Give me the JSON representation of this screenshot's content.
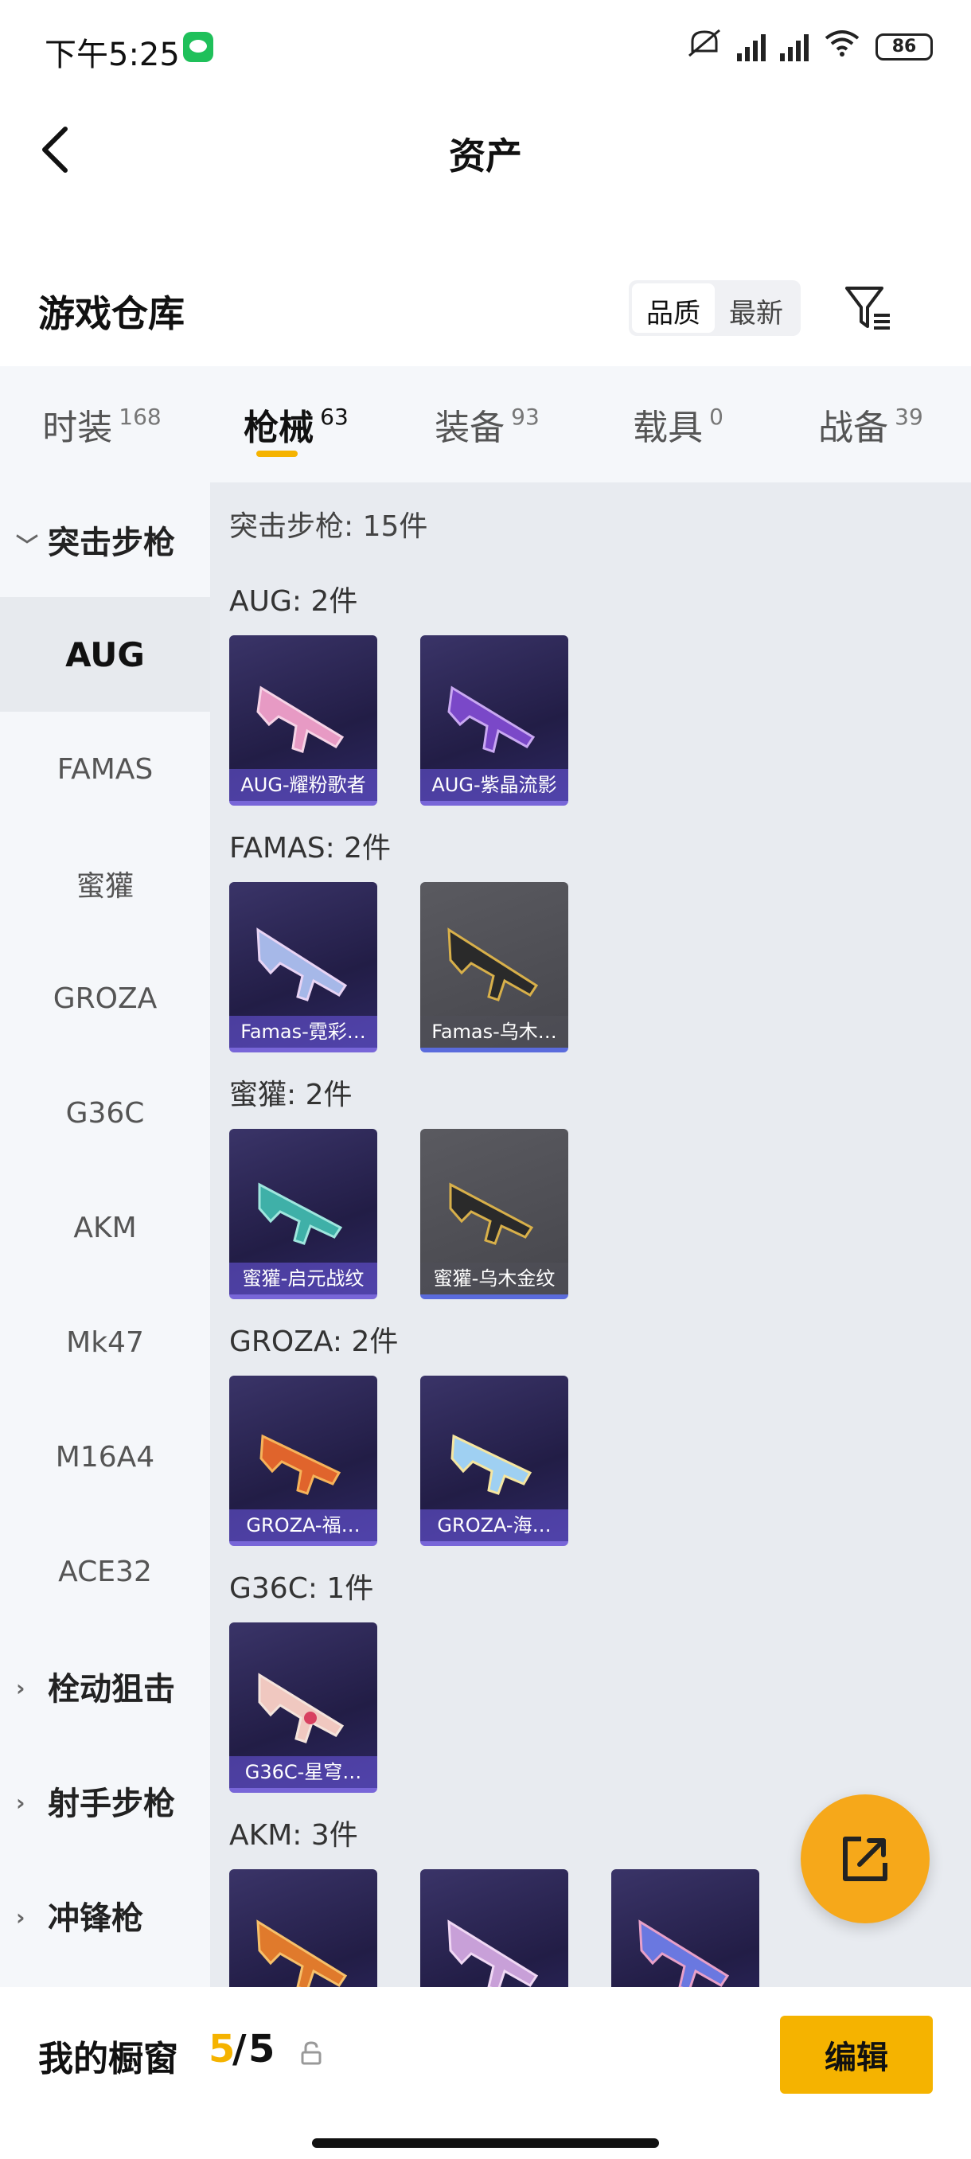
{
  "status_bar": {
    "time": "下午5:25",
    "battery": "86"
  },
  "header": {
    "title": "资产"
  },
  "warehouse": {
    "title": "游戏仓库",
    "sort_options": [
      "品质",
      "最新"
    ],
    "active_sort": "品质"
  },
  "tabs": [
    {
      "label": "时装",
      "count": "168"
    },
    {
      "label": "枪械",
      "count": "63",
      "active": true
    },
    {
      "label": "装备",
      "count": "93"
    },
    {
      "label": "载具",
      "count": "0"
    },
    {
      "label": "战备",
      "count": "39"
    }
  ],
  "sidebar": {
    "groups": [
      {
        "label": "突击步枪",
        "expanded": true
      },
      {
        "label": "栓动狙击"
      },
      {
        "label": "射手步枪"
      },
      {
        "label": "冲锋枪"
      }
    ],
    "subitems": [
      "AUG",
      "FAMAS",
      "蜜獾",
      "GROZA",
      "G36C",
      "AKM",
      "Mk47",
      "M16A4",
      "ACE32"
    ],
    "active_subitem": "AUG"
  },
  "main": {
    "category_summary": "突击步枪: 15件",
    "sections": [
      {
        "title": "AUG: 2件",
        "items": [
          {
            "name": "AUG-耀粉歌者",
            "style": "purple"
          },
          {
            "name": "AUG-紫晶流影",
            "style": "purple"
          }
        ]
      },
      {
        "title": "FAMAS: 2件",
        "items": [
          {
            "name": "Famas-霓彩…",
            "style": "purple"
          },
          {
            "name": "Famas-乌木…",
            "style": "grey"
          }
        ]
      },
      {
        "title": "蜜獾: 2件",
        "items": [
          {
            "name": "蜜獾-启元战纹",
            "style": "purple"
          },
          {
            "name": "蜜獾-乌木金纹",
            "style": "grey"
          }
        ]
      },
      {
        "title": "GROZA: 2件",
        "items": [
          {
            "name": "GROZA-福…",
            "style": "purple"
          },
          {
            "name": "GROZA-海…",
            "style": "purple"
          }
        ]
      },
      {
        "title": "G36C: 1件",
        "items": [
          {
            "name": "G36C-星穹…",
            "style": "purple"
          }
        ]
      },
      {
        "title": "AKM: 3件",
        "items": [
          {
            "name": "",
            "style": "purple"
          },
          {
            "name": "",
            "style": "purple"
          },
          {
            "name": "",
            "style": "purple"
          }
        ]
      }
    ]
  },
  "bottom_bar": {
    "label": "我的橱窗",
    "current": "5",
    "separator": "/",
    "total": "5",
    "edit_label": "编辑"
  },
  "colors": {
    "accent": "#f5b300",
    "fab": "#f6a81a",
    "card_purple": "#2a2454",
    "card_grey": "#505056"
  }
}
